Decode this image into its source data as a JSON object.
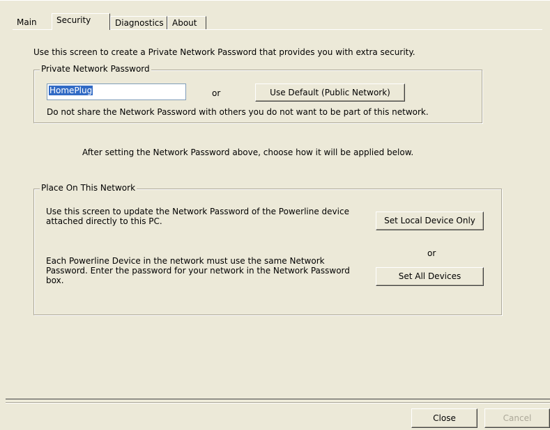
{
  "tabs": [
    {
      "label": "Main"
    },
    {
      "label": "Security"
    },
    {
      "label": "Diagnostics"
    },
    {
      "label": "About"
    }
  ],
  "active_tab": "Security",
  "intro_text": "Use this screen to create a Private Network Password that provides you with extra security.",
  "private_network": {
    "title": "Private Network Password",
    "password_value": "HomePlug",
    "or_label": "or",
    "default_button": "Use Default (Public Network)",
    "share_note": "Do not share the Network Password with others you do not want to be part of this network."
  },
  "after_text": "After setting the Network Password above, choose how it will be applied below.",
  "place_on_network": {
    "title": "Place On This Network",
    "local_description": "Use this screen to update the Network Password of the Powerline device attached directly to this PC.",
    "local_button": "Set Local Device Only",
    "or_label": "or",
    "all_description": "Each Powerline Device in the network must use the same Network Password. Enter the password for your network in the Network Password box.",
    "all_button": "Set All Devices"
  },
  "footer": {
    "close_label": "Close",
    "cancel_label": "Cancel"
  }
}
